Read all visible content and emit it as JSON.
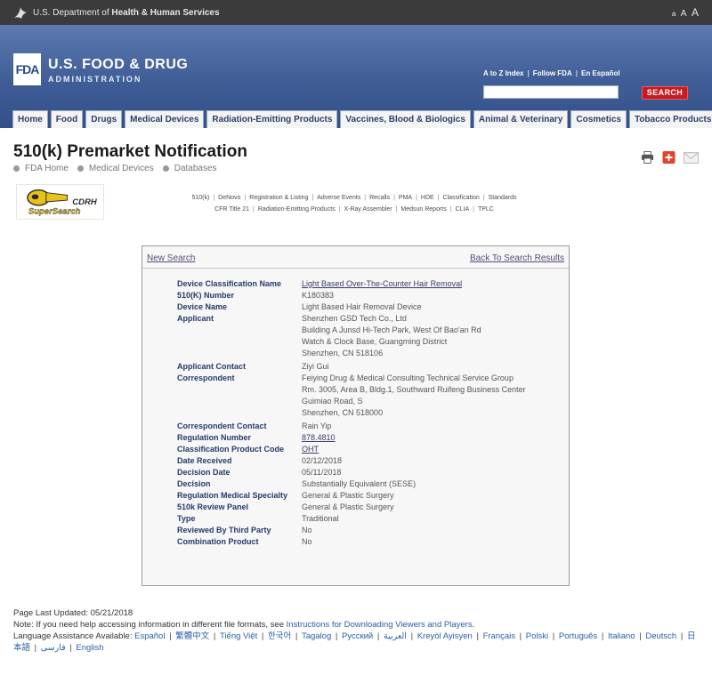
{
  "hhs_bar": {
    "prefix": "U.S. Department of ",
    "strong": "Health & Human Services",
    "font_sizes": [
      "a",
      "A",
      "A"
    ]
  },
  "header": {
    "logo_text": "FDA",
    "title": "U.S. FOOD & DRUG",
    "subtitle": "ADMINISTRATION",
    "util_links": [
      "A to Z Index",
      "Follow FDA",
      "En Español"
    ],
    "search_placeholder": "",
    "search_button": "SEARCH"
  },
  "nav": {
    "tabs": [
      "Home",
      "Food",
      "Drugs",
      "Medical Devices",
      "Radiation-Emitting Products",
      "Vaccines, Blood & Biologics",
      "Animal & Veterinary",
      "Cosmetics",
      "Tobacco Products"
    ]
  },
  "page": {
    "title": "510(k) Premarket Notification",
    "breadcrumb": [
      "FDA Home",
      "Medical Devices",
      "Databases"
    ]
  },
  "tools": [
    "print-icon",
    "share-plus-icon",
    "email-icon"
  ],
  "cdrh": {
    "line1": "CDRH",
    "line2": "SuperSearch"
  },
  "db_links": {
    "row1": [
      "510(k)",
      "DeNovo",
      "Registration & Listing",
      "Adverse Events",
      "Recalls",
      "PMA",
      "HDE",
      "Classification",
      "Standards"
    ],
    "row2": [
      "CFR Title 21",
      "Radiation-Emitting Products",
      "X-Ray Assembler",
      "Medsun Reports",
      "CLIA",
      "TPLC"
    ]
  },
  "panel": {
    "new_search": "New Search",
    "back_link": "Back To Search Results",
    "rows": [
      {
        "label": "Device Classification Name",
        "value": "Light Based Over-The-Counter Hair Removal",
        "link": true
      },
      {
        "label": "510(K) Number",
        "value": "K180383",
        "link": false
      },
      {
        "label": "Device Name",
        "value": "Light Based Hair Removal Device",
        "link": false
      },
      {
        "label": "Applicant",
        "value": "Shenzhen GSD Tech Co., Ltd\nBuilding A Junsd Hi-Tech Park, West Of Bao'an Rd\nWatch & Clock Base, Guangming District\nShenzhen,  CN 518106",
        "link": false
      },
      {
        "label": "Applicant Contact",
        "value": "Ziyi Gui",
        "link": false
      },
      {
        "label": "Correspondent",
        "value": "Feiying Drug & Medical Consulting Technical Service Group\nRm. 3005, Area B, Bldg.1, Southward Ruifeng Business Center\nGuimiao Road, S\nShenzhen,  CN 518000",
        "link": false
      },
      {
        "label": "Correspondent Contact",
        "value": "Rain Yip",
        "link": false
      },
      {
        "label": "Regulation Number",
        "value": "878.4810",
        "link": true
      },
      {
        "label": "Classification Product Code",
        "value": "OHT",
        "link": true
      },
      {
        "label": "Date Received",
        "value": "02/12/2018",
        "link": false
      },
      {
        "label": "Decision Date",
        "value": "05/11/2018",
        "link": false
      },
      {
        "label": "Decision",
        "value": "Substantially Equivalent (SESE)",
        "link": false
      },
      {
        "label": "Regulation Medical Specialty",
        "value": "General & Plastic Surgery",
        "link": false
      },
      {
        "label": "510k Review Panel",
        "value": "General & Plastic Surgery",
        "link": false
      },
      {
        "label": "Type",
        "value": "Traditional",
        "link": false
      },
      {
        "label": "Reviewed By Third Party",
        "value": "No",
        "link": false
      },
      {
        "label": "Combination Product",
        "value": "No",
        "link": false
      }
    ]
  },
  "footer": {
    "updated": "Page Last Updated: 05/21/2018",
    "note_prefix": "Note: If you need help accessing information in different file formats, see ",
    "note_link": "Instructions for Downloading Viewers and Players",
    "note_suffix": ".",
    "lang_prefix": "Language Assistance Available: ",
    "languages": [
      "Español",
      "繁體中文",
      "Tiếng Việt",
      "한국어",
      "Tagalog",
      "Русский",
      "العربية",
      "Kreyòl Ayisyen",
      "Français",
      "Polski",
      "Português",
      "Italiano",
      "Deutsch",
      "日本語",
      "فارسی",
      "English"
    ]
  }
}
